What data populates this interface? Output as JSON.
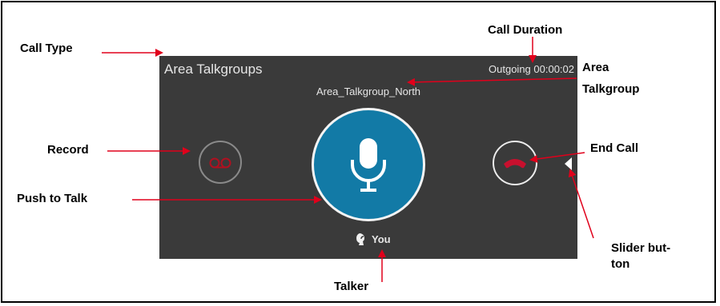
{
  "annotations": {
    "call_type": "Call Type",
    "call_duration": "Call Duration",
    "area_talkgroup_line1": "Area",
    "area_talkgroup_line2": "Talkgroup",
    "record": "Record",
    "end_call": "End Call",
    "push_to_talk": "Push to Talk",
    "slider_button_line1": "Slider but-",
    "slider_button_line2": "ton",
    "talker": "Talker"
  },
  "call_panel": {
    "call_type": "Area Talkgroups",
    "status": "Outgoing 00:00:02",
    "talkgroup_name": "Area_Talkgroup_North",
    "talker_name": "You"
  },
  "icons": {
    "record": "voicemail-record-icon",
    "push_to_talk": "microphone-icon",
    "end_call": "hang-up-phone-icon",
    "slider": "caret-left-icon",
    "talker": "speaking-person-icon"
  },
  "colors": {
    "panel_background": "#3a3a3a",
    "ptt_blue": "#127aa6",
    "end_call_red": "#c8102e",
    "record_red": "#b01020",
    "arrow_red": "#e0001b"
  }
}
